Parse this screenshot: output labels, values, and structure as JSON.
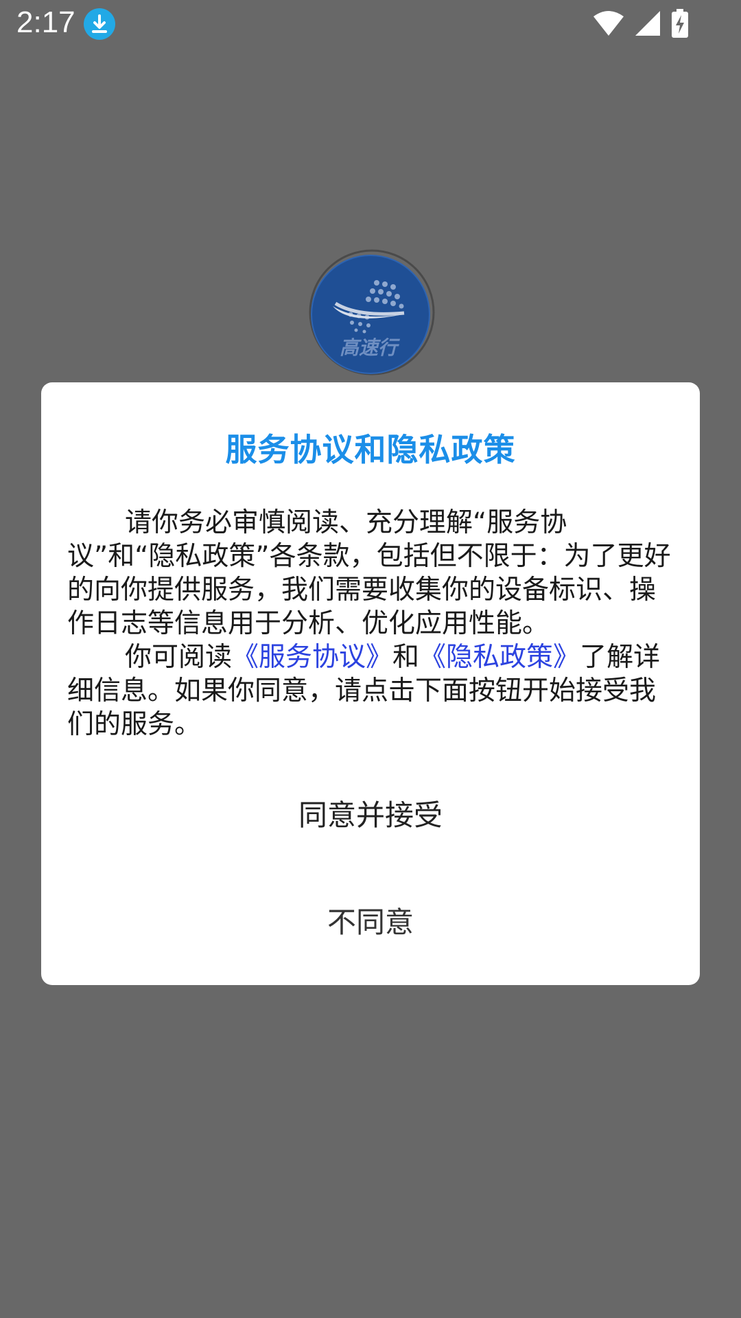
{
  "status_bar": {
    "time": "2:17",
    "icons": [
      "download-icon",
      "wifi-icon",
      "signal-icon",
      "battery-charging-icon"
    ],
    "download_color": "#22a9e6"
  },
  "splash": {
    "logo_text": "高速行",
    "logo_color": "#1f4f95"
  },
  "dialog": {
    "title": "服务协议和隐私政策",
    "title_color": "#1b8ee8",
    "paragraph1": "请你务必审慎阅读、充分理解“服务协议”和“隐私政策”各条款，包括但不限于：为了更好的向你提供服务，我们需要收集你的设备标识、操作日志等信息用于分析、优化应用性能。",
    "paragraph2": {
      "prefix": "你可阅读",
      "link_service": "《服务协议》",
      "middle": "和",
      "link_privacy": "《隐私政策》",
      "suffix": "了解详细信息。如果你同意，请点击下面按钮开始接受我们的服务。"
    },
    "link_color": "#2c43e0",
    "agree_button": "同意并接受",
    "disagree_button": "不同意"
  }
}
